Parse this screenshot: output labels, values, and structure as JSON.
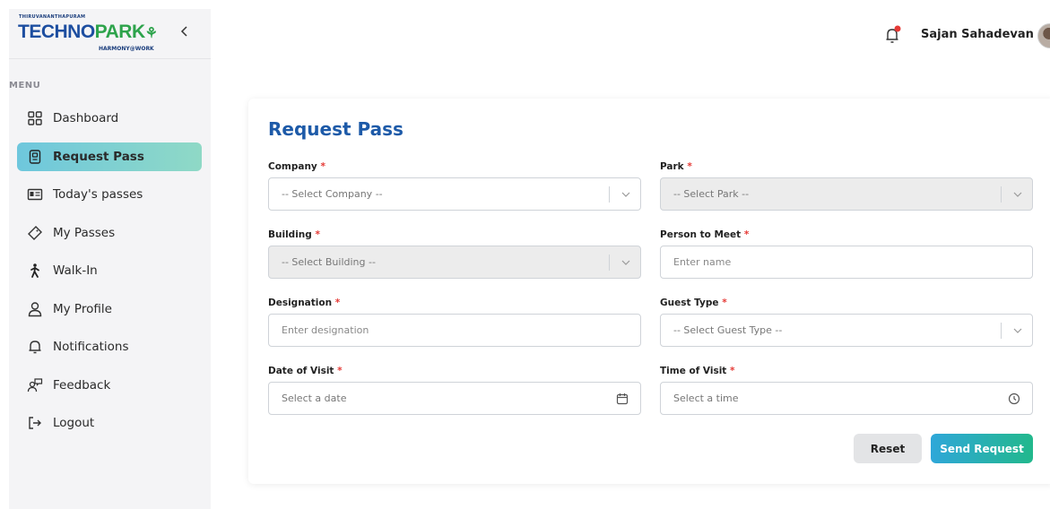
{
  "logo": {
    "top_text": "THIRUVANANTHAPURAM",
    "main_part1": "TECHNO",
    "main_part2": "PARK",
    "sub_text": "HARMONY@WORK"
  },
  "sidebar": {
    "menu_title": "MENU",
    "items": [
      {
        "label": "Dashboard",
        "icon": "dashboard-icon"
      },
      {
        "label": "Request Pass",
        "icon": "request-pass-icon",
        "active": true
      },
      {
        "label": "Today's passes",
        "icon": "id-card-icon"
      },
      {
        "label": "My Passes",
        "icon": "ticket-icon"
      },
      {
        "label": "Walk-In",
        "icon": "walking-person-icon"
      },
      {
        "label": "My Profile",
        "icon": "user-icon"
      },
      {
        "label": "Notifications",
        "icon": "bell-icon"
      },
      {
        "label": "Feedback",
        "icon": "feedback-icon"
      },
      {
        "label": "Logout",
        "icon": "logout-icon"
      }
    ]
  },
  "header": {
    "user_name": "Sajan Sahadevan",
    "notification_dot_color": "#e53935"
  },
  "form": {
    "title": "Request Pass",
    "required_marker": "*",
    "company": {
      "label": "Company",
      "placeholder": "-- Select Company --"
    },
    "park": {
      "label": "Park",
      "placeholder": "-- Select Park --"
    },
    "building": {
      "label": "Building",
      "placeholder": "-- Select Building --"
    },
    "person_to_meet": {
      "label": "Person to Meet",
      "placeholder": "Enter name"
    },
    "designation": {
      "label": "Designation",
      "placeholder": "Enter designation"
    },
    "guest_type": {
      "label": "Guest Type",
      "placeholder": "-- Select Guest Type --"
    },
    "date_of_visit": {
      "label": "Date of Visit",
      "placeholder": "Select a date"
    },
    "time_of_visit": {
      "label": "Time of Visit",
      "placeholder": "Select a time"
    },
    "reset_label": "Reset",
    "send_label": "Send Request"
  },
  "colors": {
    "accent_blue": "#1d5aa8",
    "active_menu_gradient_start": "#6ec7dd",
    "active_menu_gradient_end": "#8fd9c6",
    "send_gradient_start": "#2fa7d9",
    "send_gradient_end": "#22b88c"
  }
}
